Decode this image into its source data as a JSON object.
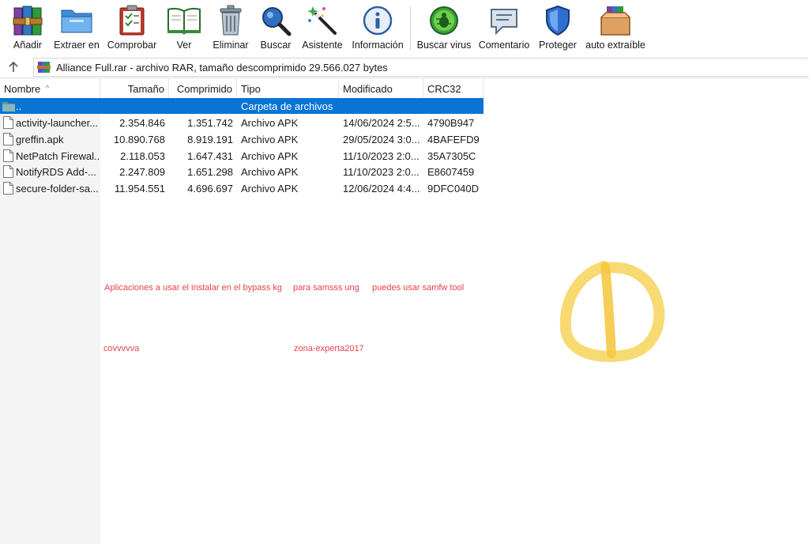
{
  "toolbar": {
    "buttons": [
      {
        "label": "Añadir",
        "icon": "archive-books-icon"
      },
      {
        "label": "Extraer en",
        "icon": "folder-extract-icon"
      },
      {
        "label": "Comprobar",
        "icon": "clipboard-check-icon"
      },
      {
        "label": "Ver",
        "icon": "open-book-icon"
      },
      {
        "label": "Eliminar",
        "icon": "trash-can-icon"
      },
      {
        "label": "Buscar",
        "icon": "magnifier-icon"
      },
      {
        "label": "Asistente",
        "icon": "magic-wand-icon"
      },
      {
        "label": "Información",
        "icon": "info-icon"
      },
      {
        "label": "Buscar virus",
        "icon": "virus-bug-icon"
      },
      {
        "label": "Comentario",
        "icon": "comment-icon"
      },
      {
        "label": "Proteger",
        "icon": "shield-icon"
      },
      {
        "label": "auto extraíble",
        "icon": "sfx-box-icon"
      }
    ]
  },
  "address": {
    "text": "Alliance Full.rar - archivo RAR, tamaño descomprimido 29.566.027 bytes"
  },
  "columns": {
    "name": "Nombre",
    "size": "Tamaño",
    "packed": "Comprimido",
    "type": "Tipo",
    "modified": "Modificado",
    "crc": "CRC32"
  },
  "parent_row": {
    "name": "..",
    "type": "Carpeta de archivos"
  },
  "files": [
    {
      "name": "activity-launcher...",
      "size": "2.354.846",
      "packed": "1.351.742",
      "type": "Archivo APK",
      "modified": "14/06/2024 2:5...",
      "crc": "4790B947"
    },
    {
      "name": "greffin.apk",
      "size": "10.890.768",
      "packed": "8.919.191",
      "type": "Archivo APK",
      "modified": "29/05/2024 3:0...",
      "crc": "4BAFEFD9"
    },
    {
      "name": "NetPatch Firewal...",
      "size": "2.118.053",
      "packed": "1.647.431",
      "type": "Archivo APK",
      "modified": "11/10/2023 2:0...",
      "crc": "35A7305C"
    },
    {
      "name": "NotifyRDS Add-...",
      "size": "2.247.809",
      "packed": "1.651.298",
      "type": "Archivo APK",
      "modified": "11/10/2023 2:0...",
      "crc": "E8607459"
    },
    {
      "name": "secure-folder-sa...",
      "size": "11.954.551",
      "packed": "4.696.697",
      "type": "Archivo APK",
      "modified": "12/06/2024 4:4...",
      "crc": "9DFC040D"
    }
  ],
  "annotations": {
    "line1_a": "Aplicaciones a usar el instalar en el bypass kg",
    "line1_b": "para samsss ung",
    "line1_c": "puedes usar samfw tool",
    "line2_a": "covvvvva",
    "line2_b": "zona-experta2017"
  },
  "colors": {
    "selection": "#0a74d4",
    "annotation_text": "#e8404b",
    "scribble": "#f7d35a"
  }
}
